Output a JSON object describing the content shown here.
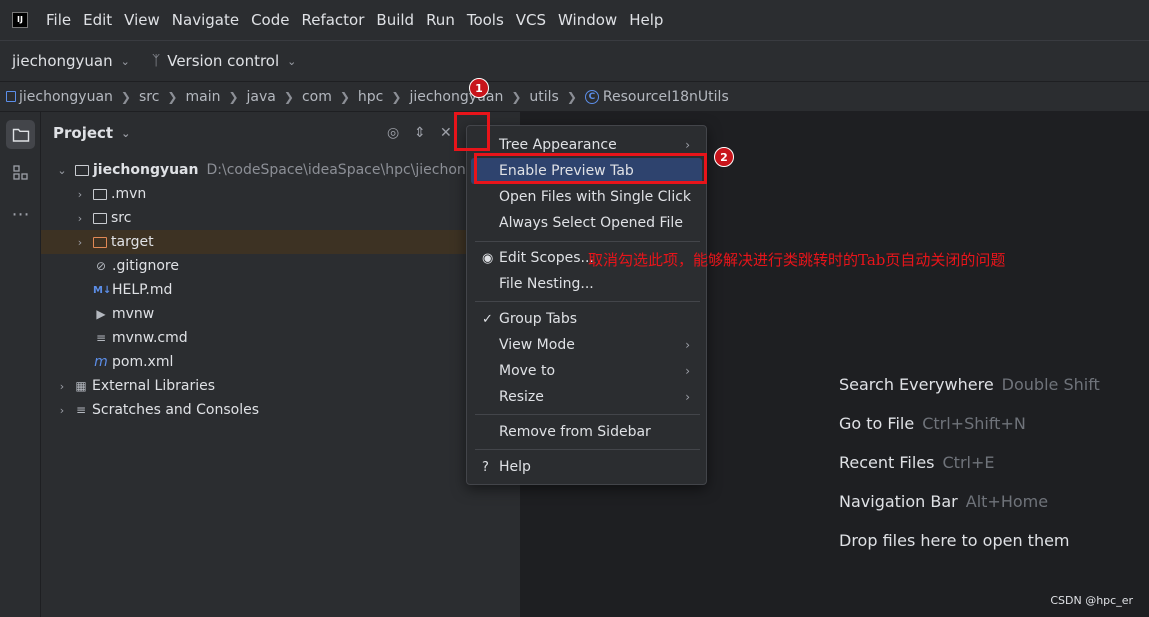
{
  "menubar": {
    "logo_text": "IJ",
    "items": [
      "File",
      "Edit",
      "View",
      "Navigate",
      "Code",
      "Refactor",
      "Build",
      "Run",
      "Tools",
      "VCS",
      "Window",
      "Help"
    ]
  },
  "toolbar": {
    "project_name": "jiechongyuan",
    "version_control": "Version control"
  },
  "breadcrumb": {
    "items": [
      "jiechongyuan",
      "src",
      "main",
      "java",
      "com",
      "hpc",
      "jiechongyuan",
      "utils"
    ],
    "current_file": "ResourceI18nUtils"
  },
  "project_panel": {
    "title": "Project",
    "tree": {
      "root": {
        "name": "jiechongyuan",
        "path": "D:\\codeSpace\\ideaSpace\\hpc\\jiechongyu"
      },
      "children": [
        {
          "name": ".mvn",
          "kind": "folder"
        },
        {
          "name": "src",
          "kind": "folder"
        },
        {
          "name": "target",
          "kind": "excluded-folder"
        },
        {
          "name": ".gitignore",
          "kind": "file"
        },
        {
          "name": "HELP.md",
          "kind": "file"
        },
        {
          "name": "mvnw",
          "kind": "file"
        },
        {
          "name": "mvnw.cmd",
          "kind": "file"
        },
        {
          "name": "pom.xml",
          "kind": "file"
        }
      ],
      "external_libraries": "External Libraries",
      "scratches": "Scratches and Consoles"
    }
  },
  "popup_menu": {
    "items": {
      "tree_appearance": "Tree Appearance",
      "enable_preview_tab": "Enable Preview Tab",
      "open_single_click": "Open Files with Single Click",
      "always_select": "Always Select Opened File",
      "edit_scopes": "Edit Scopes...",
      "file_nesting": "File Nesting...",
      "group_tabs": "Group Tabs",
      "view_mode": "View Mode",
      "move_to": "Move to",
      "resize": "Resize",
      "remove_sidebar": "Remove from Sidebar",
      "help": "Help"
    }
  },
  "editor_hints": [
    {
      "action": "Search Everywhere",
      "shortcut": "Double Shift"
    },
    {
      "action": "Go to File",
      "shortcut": "Ctrl+Shift+N"
    },
    {
      "action": "Recent Files",
      "shortcut": "Ctrl+E"
    },
    {
      "action": "Navigation Bar",
      "shortcut": "Alt+Home"
    },
    {
      "action": "Drop files here to open them",
      "shortcut": ""
    }
  ],
  "annotations": {
    "badge_1": "1",
    "badge_2": "2",
    "note": "取消勾选此项，能够解决进行类跳转时的Tab页自动关闭的问题"
  },
  "watermark": "CSDN @hpc_er",
  "colors": {
    "background": "#1e1f22",
    "panel": "#2b2d30",
    "selection": "#2e436e",
    "annotation_red": "#e8141a",
    "excluded_row": "#3d3223"
  }
}
